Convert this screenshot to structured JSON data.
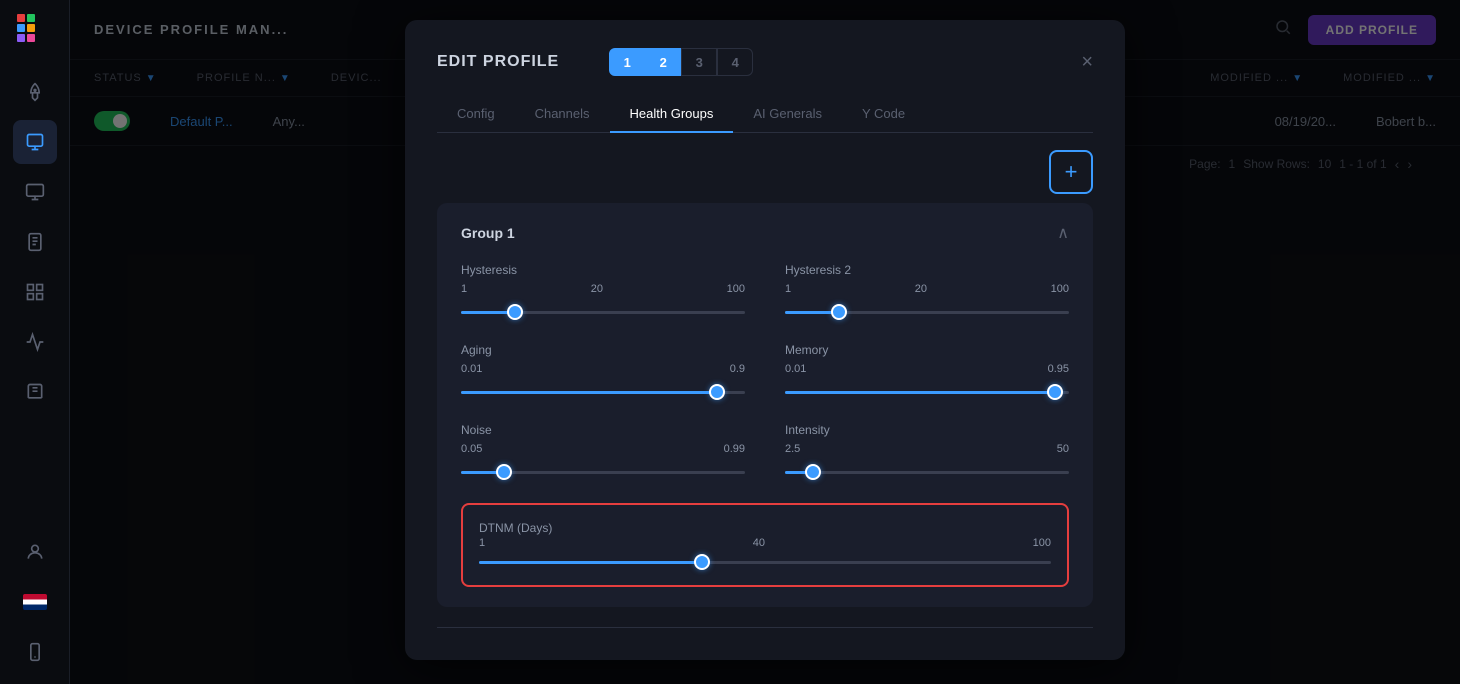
{
  "sidebar": {
    "items": [
      {
        "name": "rocket-icon",
        "icon": "🚀",
        "active": false
      },
      {
        "name": "device-icon",
        "icon": "📋",
        "active": true
      },
      {
        "name": "monitor-icon",
        "icon": "🖥",
        "active": false
      },
      {
        "name": "document-icon",
        "icon": "📄",
        "active": false
      },
      {
        "name": "grid-icon",
        "icon": "⊞",
        "active": false
      },
      {
        "name": "chart-icon",
        "icon": "📊",
        "active": false
      },
      {
        "name": "library-icon",
        "icon": "📚",
        "active": false
      },
      {
        "name": "user-icon",
        "icon": "👤",
        "active": false
      }
    ]
  },
  "topbar": {
    "title": "DEVICE PROFILE MAN...",
    "search_label": "Search",
    "add_profile_label": "ADD PROFILE"
  },
  "table": {
    "headers": [
      "STATUS",
      "PROFILE N...",
      "DEVIC...",
      "MODIFIED ...",
      "MODIFIED ..."
    ],
    "rows": [
      {
        "status": "on",
        "profile": "Default P...",
        "device": "Any...",
        "modified_date": "08/19/20...",
        "modified_by": "Bobert b..."
      }
    ],
    "pagination": {
      "page_label": "Page:",
      "page": "1",
      "show_rows_label": "Show Rows:",
      "show_rows": "10",
      "range": "1 - 1 of 1"
    }
  },
  "modal": {
    "title": "EDIT PROFILE",
    "steps": [
      "1",
      "2",
      "3",
      "4"
    ],
    "active_steps": [
      0,
      1
    ],
    "tabs": [
      "Config",
      "Channels",
      "Health Groups",
      "AI Generals",
      "Y Code"
    ],
    "active_tab": 2,
    "close_label": "×",
    "add_group_label": "+",
    "group": {
      "title": "Group 1",
      "sliders": [
        {
          "label": "Hysteresis",
          "min": "1",
          "value_display": "20",
          "max": "100",
          "percent": 19
        },
        {
          "label": "Hysteresis 2",
          "min": "1",
          "value_display": "20",
          "max": "100",
          "percent": 19
        },
        {
          "label": "Aging",
          "min": "0.01",
          "value_display": "0.9",
          "max": "",
          "percent": 90
        },
        {
          "label": "Memory",
          "min": "0.01",
          "value_display": "0.95",
          "max": "",
          "percent": 95
        },
        {
          "label": "Noise",
          "min": "0.05",
          "value_display": "0.99",
          "max": "",
          "percent": 15
        },
        {
          "label": "Intensity",
          "min": "2.5",
          "value_display": "50",
          "max": "",
          "percent": 10
        }
      ],
      "dtnm": {
        "label": "DTNM (Days)",
        "min": "1",
        "value_display": "40",
        "max": "100",
        "percent": 39
      }
    }
  },
  "colors": {
    "accent": "#3b9bff",
    "active_bg": "#1a2235",
    "danger": "#e53e3e",
    "toggle_on": "#22c55e"
  }
}
